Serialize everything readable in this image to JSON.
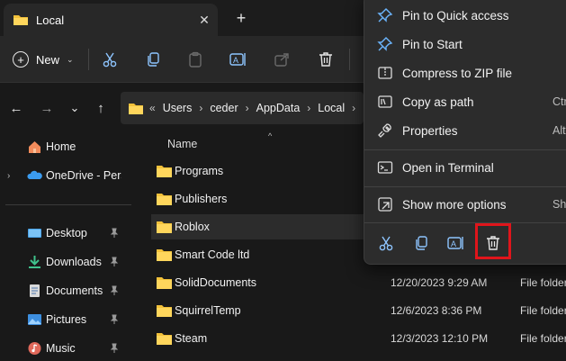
{
  "window": {
    "tab_title": "Local",
    "tab_close": "✕",
    "new_tab": "+"
  },
  "toolbar": {
    "new_label": "New",
    "new_caret": "⌄",
    "icons": [
      "cut-icon",
      "copy-icon",
      "paste-icon",
      "rename-icon",
      "share-icon",
      "delete-icon"
    ]
  },
  "navigation": {
    "back": "←",
    "forward": "→",
    "recent": "⌄",
    "up": "↑",
    "breadcrumb_overflow": "«",
    "breadcrumb": [
      "Users",
      "ceder",
      "AppData",
      "Local"
    ],
    "separator": "›"
  },
  "sidebar": {
    "items": [
      {
        "label": "Home",
        "icon": "home-icon"
      },
      {
        "label": "OneDrive - Personal",
        "icon": "onedrive-icon"
      },
      {
        "label": "Desktop",
        "icon": "desktop-icon",
        "pinned": true
      },
      {
        "label": "Downloads",
        "icon": "downloads-icon",
        "pinned": true
      },
      {
        "label": "Documents",
        "icon": "documents-icon",
        "pinned": true
      },
      {
        "label": "Pictures",
        "icon": "pictures-icon",
        "pinned": true
      },
      {
        "label": "Music",
        "icon": "music-icon",
        "pinned": true
      }
    ],
    "expander": "›"
  },
  "content": {
    "column_name": "Name",
    "sort_indicator": "^",
    "rows": [
      {
        "name": "Programs",
        "date": "",
        "type": ""
      },
      {
        "name": "Publishers",
        "date": "",
        "type": ""
      },
      {
        "name": "Roblox",
        "date": "",
        "type": "",
        "selected": true
      },
      {
        "name": "Smart Code ltd",
        "date": "",
        "type": ""
      },
      {
        "name": "SolidDocuments",
        "date": "12/20/2023 9:29 AM",
        "type": "File folder"
      },
      {
        "name": "SquirrelTemp",
        "date": "12/6/2023 8:36 PM",
        "type": "File folder"
      },
      {
        "name": "Steam",
        "date": "12/3/2023 12:10 PM",
        "type": "File folder"
      }
    ]
  },
  "context_menu": {
    "items": [
      {
        "label": "Pin to Quick access",
        "icon": "pin-icon",
        "key": ""
      },
      {
        "label": "Pin to Start",
        "icon": "pin-start-icon",
        "key": ""
      },
      {
        "label": "Compress to ZIP file",
        "icon": "zip-icon",
        "key": ""
      },
      {
        "label": "Copy as path",
        "icon": "copy-path-icon",
        "key": "Ctr"
      },
      {
        "label": "Properties",
        "icon": "properties-icon",
        "key": "Alt"
      },
      {
        "label": "Open in Terminal",
        "icon": "terminal-icon",
        "key": ""
      },
      {
        "label": "Show more options",
        "icon": "more-options-icon",
        "key": "Shi"
      }
    ],
    "bottom_tools": [
      "cut-icon",
      "copy-icon",
      "rename-icon",
      "delete-icon"
    ],
    "highlighted_tool": "delete-icon"
  },
  "colors": {
    "accent_folder": "#f3c13a",
    "highlight": "#e0151b",
    "menu_icon_blue": "#6cb6ff"
  }
}
